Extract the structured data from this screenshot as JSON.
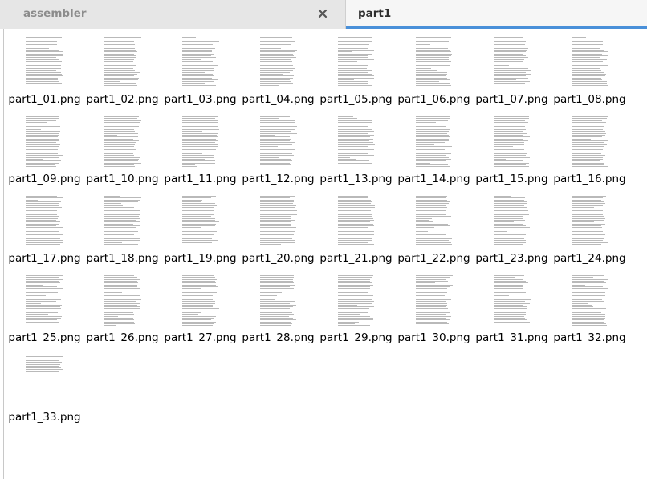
{
  "tabs": [
    {
      "label": "assembler",
      "active": false,
      "close_icon": "close-icon"
    },
    {
      "label": "part1",
      "active": true
    }
  ],
  "colors": {
    "active_tab_underline": "#4a90d9",
    "tabbar_bg": "#f1f1f1"
  },
  "files": [
    {
      "name": "part1_01.png"
    },
    {
      "name": "part1_02.png"
    },
    {
      "name": "part1_03.png"
    },
    {
      "name": "part1_04.png"
    },
    {
      "name": "part1_05.png"
    },
    {
      "name": "part1_06.png"
    },
    {
      "name": "part1_07.png"
    },
    {
      "name": "part1_08.png"
    },
    {
      "name": "part1_09.png"
    },
    {
      "name": "part1_10.png"
    },
    {
      "name": "part1_11.png"
    },
    {
      "name": "part1_12.png"
    },
    {
      "name": "part1_13.png"
    },
    {
      "name": "part1_14.png"
    },
    {
      "name": "part1_15.png"
    },
    {
      "name": "part1_16.png"
    },
    {
      "name": "part1_17.png"
    },
    {
      "name": "part1_18.png"
    },
    {
      "name": "part1_19.png"
    },
    {
      "name": "part1_20.png"
    },
    {
      "name": "part1_21.png"
    },
    {
      "name": "part1_22.png"
    },
    {
      "name": "part1_23.png"
    },
    {
      "name": "part1_24.png"
    },
    {
      "name": "part1_25.png"
    },
    {
      "name": "part1_26.png"
    },
    {
      "name": "part1_27.png"
    },
    {
      "name": "part1_28.png"
    },
    {
      "name": "part1_29.png"
    },
    {
      "name": "part1_30.png"
    },
    {
      "name": "part1_31.png"
    },
    {
      "name": "part1_32.png"
    },
    {
      "name": "part1_33.png"
    }
  ]
}
